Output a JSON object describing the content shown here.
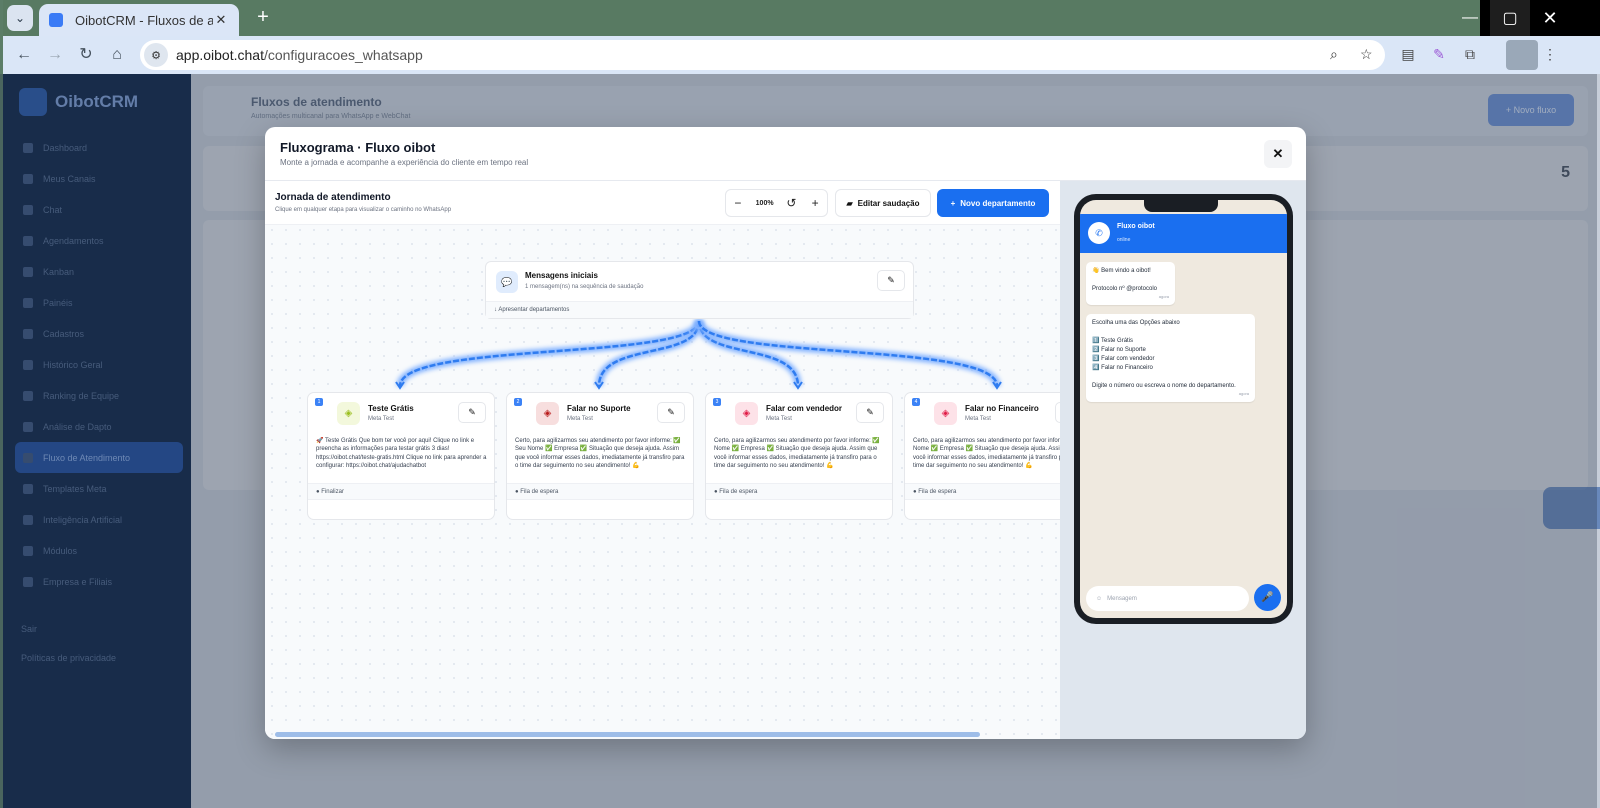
{
  "browser": {
    "tab_title": "OibotCRM - Fluxos de atendim",
    "url_host": "app.oibot.chat",
    "url_path": "/configuracoes_whatsapp"
  },
  "modal": {
    "title": "Fluxograma · Fluxo oibot",
    "subtitle": "Monte a jornada e acompanhe a experiência do cliente em tempo real",
    "canvas_title": "Jornada de atendimento",
    "canvas_subtitle": "Clique em qualquer etapa para visualizar o caminho no WhatsApp",
    "zoom_level": "100%",
    "edit_greeting_label": "Editar saudação",
    "new_department_label": "Novo departamento",
    "root_node": {
      "title": "Mensagens iniciais",
      "subtitle": "1 mensagem(ns) na sequência de saudação",
      "footer": "Apresentar departamentos"
    },
    "departments": [
      {
        "number": "1",
        "title": "Teste Grátis",
        "subtitle": "Meta Test",
        "body": "🚀 Teste Grátis Que bom ter você por aqui! Clique no link e preencha as informações para testar grátis 3 dias! https://oibot.chat/teste-gratis.html Clique no link para aprender a configurar: https://oibot.chat/ajudachatbot",
        "footer": "Finalizar",
        "icon_color": "#9bbf1f",
        "icon_bg": "#f3f8dc"
      },
      {
        "number": "2",
        "title": "Falar no Suporte",
        "subtitle": "Meta Test",
        "body": "Certo, para agilizarmos seu atendimento por favor informe: ✅ Seu Nome ✅ Empresa ✅ Situação que deseja ajuda. Assim que você informar esses dados, imediatamente já transfiro para o time dar seguimento no seu atendimento! 💪",
        "footer": "Fila de espera",
        "icon_color": "#b91c1c",
        "icon_bg": "#f7dede"
      },
      {
        "number": "3",
        "title": "Falar com vendedor",
        "subtitle": "Meta Test",
        "body": "Certo, para agilizarmos seu atendimento por favor informe: ✅ Nome ✅ Empresa ✅ Situação que deseja ajuda. Assim que você informar esses dados, imediatamente já transfiro para o time dar seguimento no seu atendimento! 💪",
        "footer": "Fila de espera",
        "icon_color": "#e11d48",
        "icon_bg": "#fde2e8"
      },
      {
        "number": "4",
        "title": "Falar no Financeiro",
        "subtitle": "Meta Test",
        "body": "Certo, para agilizarmos seu atendimento por favor informe: ✅ Nome ✅ Empresa ✅ Situação que deseja ajuda. Assim que você informar esses dados, imediatamente já transfiro para o time dar seguimento no seu atendimento! 💪",
        "footer": "Fila de espera",
        "icon_color": "#e11d48",
        "icon_bg": "#fde2e8"
      }
    ]
  },
  "phone": {
    "contact_name": "Fluxo oibot",
    "contact_status": "online",
    "messages": [
      {
        "text": "👋 Bem vindo a oibot!\n\nProtocolo nº @protocolo",
        "time": "agora"
      },
      {
        "text": "Escolha uma das Opções abaixo\n\n1️⃣ Teste Grátis\n2️⃣ Falar no Suporte\n3️⃣ Falar com vendedor\n4️⃣ Falar no Financeiro\n\nDigite o número ou escreva o nome do departamento.",
        "time": "agora"
      }
    ],
    "input_placeholder": "Mensagem"
  },
  "background": {
    "app_name": "OibotCRM",
    "page_title": "Fluxos de atendimento",
    "page_subtitle": "Automações multicanal para WhatsApp e WebChat",
    "new_flow_label": "+ Novo fluxo",
    "sidebar_items": [
      "Dashboard",
      "Meus Canais",
      "Chat",
      "Agendamentos",
      "Kanban",
      "Painéis",
      "Cadastros",
      "Histórico Geral",
      "Ranking de Equipe",
      "Análise de Dapto",
      "Fluxo de Atendimento",
      "Templates Meta",
      "Inteligência Artificial",
      "Módulos",
      "Empresa e Filiais"
    ],
    "sidebar_active_index": 10,
    "logout": "Sair",
    "privacy": "Políticas de privacidade",
    "stat_value": "5"
  },
  "colors": {
    "accent": "#1a6ff0",
    "sidebar": "#11284a",
    "flow_line": "#2f7cf0"
  }
}
